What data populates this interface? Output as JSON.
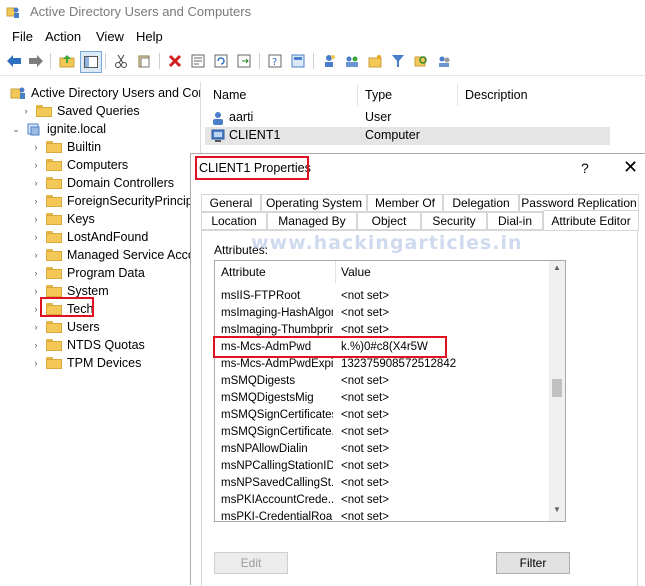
{
  "window": {
    "title": "Active Directory Users and Computers"
  },
  "menu": [
    "File",
    "Action",
    "View",
    "Help"
  ],
  "tree": {
    "root": "Active Directory Users and Com",
    "items": [
      {
        "label": "Saved Queries"
      },
      {
        "label": "ignite.local"
      },
      {
        "label": "Builtin"
      },
      {
        "label": "Computers"
      },
      {
        "label": "Domain Controllers"
      },
      {
        "label": "ForeignSecurityPrincipa"
      },
      {
        "label": "Keys"
      },
      {
        "label": "LostAndFound"
      },
      {
        "label": "Managed Service Acco"
      },
      {
        "label": "Program Data"
      },
      {
        "label": "System"
      },
      {
        "label": "Tech"
      },
      {
        "label": "Users"
      },
      {
        "label": "NTDS Quotas"
      },
      {
        "label": "TPM Devices"
      }
    ]
  },
  "list": {
    "columns": [
      "Name",
      "Type",
      "Description"
    ],
    "rows": [
      {
        "name": "aarti",
        "type": "User"
      },
      {
        "name": "CLIENT1",
        "type": "Computer"
      }
    ]
  },
  "dialog": {
    "title": "CLIENT1 Properties",
    "help": "?",
    "close": "✕",
    "tabs_row1": [
      "General",
      "Operating System",
      "Member Of",
      "Delegation",
      "Password Replication"
    ],
    "tabs_row2": [
      "Location",
      "Managed By",
      "Object",
      "Security",
      "Dial-in",
      "Attribute Editor"
    ],
    "attributes_label": "Attributes:",
    "grid_headers": [
      "Attribute",
      "Value"
    ],
    "rows": [
      {
        "attr": "msIIS-FTPRoot",
        "value": "<not set>"
      },
      {
        "attr": "msImaging-HashAlgor...",
        "value": "<not set>"
      },
      {
        "attr": "msImaging-Thumbprin...",
        "value": "<not set>"
      },
      {
        "attr": "ms-Mcs-AdmPwd",
        "value": "k.%)0#c8(X4r5W"
      },
      {
        "attr": "ms-Mcs-AdmPwdExpi...",
        "value": "132375908572512842"
      },
      {
        "attr": "mSMQDigests",
        "value": "<not set>"
      },
      {
        "attr": "mSMQDigestsMig",
        "value": "<not set>"
      },
      {
        "attr": "mSMQSignCertificates",
        "value": "<not set>"
      },
      {
        "attr": "mSMQSignCertificate...",
        "value": "<not set>"
      },
      {
        "attr": "msNPAllowDialin",
        "value": "<not set>"
      },
      {
        "attr": "msNPCallingStationID",
        "value": "<not set>"
      },
      {
        "attr": "msNPSavedCallingSt...",
        "value": "<not set>"
      },
      {
        "attr": "msPKIAccountCrede...",
        "value": "<not set>"
      },
      {
        "attr": "msPKI-CredentialRoa...",
        "value": "<not set>"
      }
    ],
    "edit_button": "Edit",
    "filter_button": "Filter"
  },
  "watermark": "www.hackingarticles.in",
  "colors": {
    "highlight": "#e0121f",
    "folder": "#f3c857",
    "selected_row": "#e5e5e5"
  }
}
